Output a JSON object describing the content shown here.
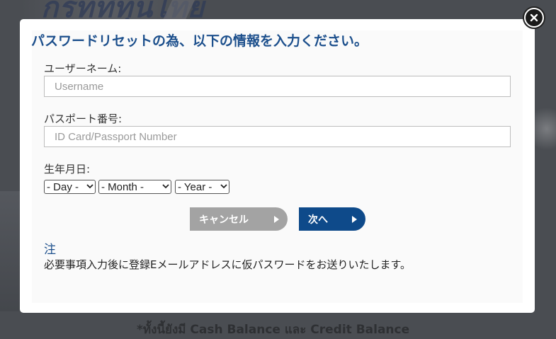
{
  "background": {
    "headline": "กรทที่ทุนไทย",
    "footer_text": "*ทั้งนี้ยังมี Cash Balance และ Credit Balance"
  },
  "dialog": {
    "title": "パスワードリセットの為、以下の情報を入力ください。",
    "close_icon": "close-icon",
    "username": {
      "label": "ユーザーネーム:",
      "placeholder": "Username",
      "value": ""
    },
    "passport": {
      "label": "パスポート番号:",
      "placeholder": "ID Card/Passport Number",
      "value": ""
    },
    "birthdate": {
      "label": "生年月日:",
      "day": "- Day -",
      "month": "- Month -",
      "year": "- Year -"
    },
    "buttons": {
      "cancel": "キャンセル",
      "next": "次へ"
    },
    "note": {
      "heading": "注",
      "text": "必要事項入力後に登録Eメールアドレスに仮パスワードをお送りいたします。"
    }
  },
  "colors": {
    "accent": "#1c4f8c",
    "next_button": "#0e4a8a",
    "cancel_button": "#a3a3a3"
  }
}
